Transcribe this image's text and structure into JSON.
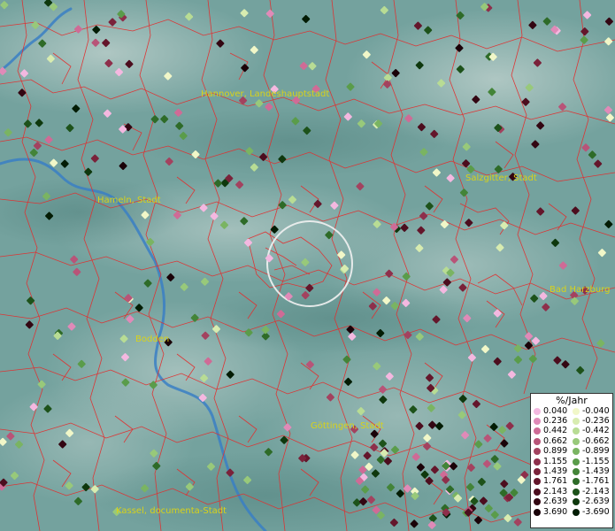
{
  "cities": [
    {
      "name": "Hannover, Landeshauptstadt"
    },
    {
      "name": "Salzgitter, Stadt"
    },
    {
      "name": "Hameln, Stadt"
    },
    {
      "name": "Bad Harzburg"
    },
    {
      "name": "Bodden"
    },
    {
      "name": "Göttingen, Stadt"
    },
    {
      "name": "Kassel, documenta-Stadt"
    }
  ],
  "legend": {
    "title": "%/Jahr",
    "positive": [
      {
        "label": "0.040",
        "color": "#f4b8e0"
      },
      {
        "label": "0.236",
        "color": "#e08ab8"
      },
      {
        "label": "0.442",
        "color": "#cf6b96"
      },
      {
        "label": "0.662",
        "color": "#b85478"
      },
      {
        "label": "0.899",
        "color": "#a3425f"
      },
      {
        "label": "1.155",
        "color": "#8e2f4b"
      },
      {
        "label": "1.439",
        "color": "#7a223a"
      },
      {
        "label": "1.761",
        "color": "#64162b"
      },
      {
        "label": "2.143",
        "color": "#4c0d1e"
      },
      {
        "label": "2.639",
        "color": "#330612"
      },
      {
        "label": "3.690",
        "color": "#1a0208"
      }
    ],
    "negative": [
      {
        "label": "-0.040",
        "color": "#f1f7c8"
      },
      {
        "label": "-0.236",
        "color": "#d8ecb0"
      },
      {
        "label": "-0.442",
        "color": "#b8dc94"
      },
      {
        "label": "-0.662",
        "color": "#98c97a"
      },
      {
        "label": "-0.899",
        "color": "#7ab462"
      },
      {
        "label": "-1.155",
        "color": "#5a9c4a"
      },
      {
        "label": "-1.439",
        "color": "#438438"
      },
      {
        "label": "-1.761",
        "color": "#2e6b28"
      },
      {
        "label": "-2.143",
        "color": "#1d521a"
      },
      {
        "label": "-2.639",
        "color": "#0e380d"
      },
      {
        "label": "-3.690",
        "color": "#031c04"
      }
    ]
  },
  "colors": {
    "border_lines": "#e03030",
    "river": "#3a7fc4",
    "label": "#d8d21a",
    "focus_circle": "#f2f2f2"
  }
}
